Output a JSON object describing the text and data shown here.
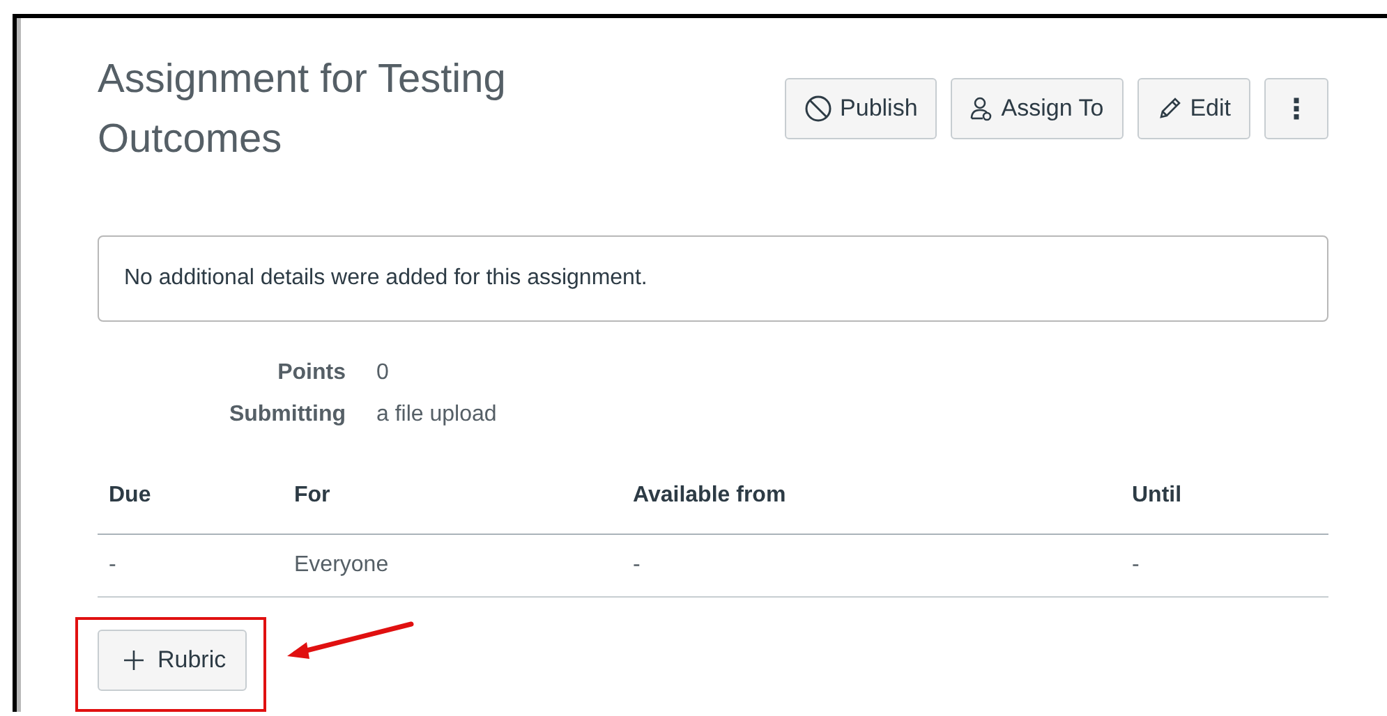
{
  "title": "Assignment for Testing Outcomes",
  "actions": [
    {
      "kind": "publish",
      "label": "Publish"
    },
    {
      "kind": "assign",
      "label": "Assign To"
    },
    {
      "kind": "edit",
      "label": "Edit"
    },
    {
      "kind": "more",
      "label": "⋮"
    }
  ],
  "description": "No additional details were added for this assignment.",
  "details": [
    {
      "label": "Points",
      "value": "0"
    },
    {
      "label": "Submitting",
      "value": "a file upload"
    }
  ],
  "table": {
    "columns": [
      "Due",
      "For",
      "Available from",
      "Until"
    ],
    "rows": [
      [
        "-",
        "Everyone",
        "-",
        "-"
      ]
    ]
  },
  "rubric_button": {
    "label": "Rubric"
  }
}
